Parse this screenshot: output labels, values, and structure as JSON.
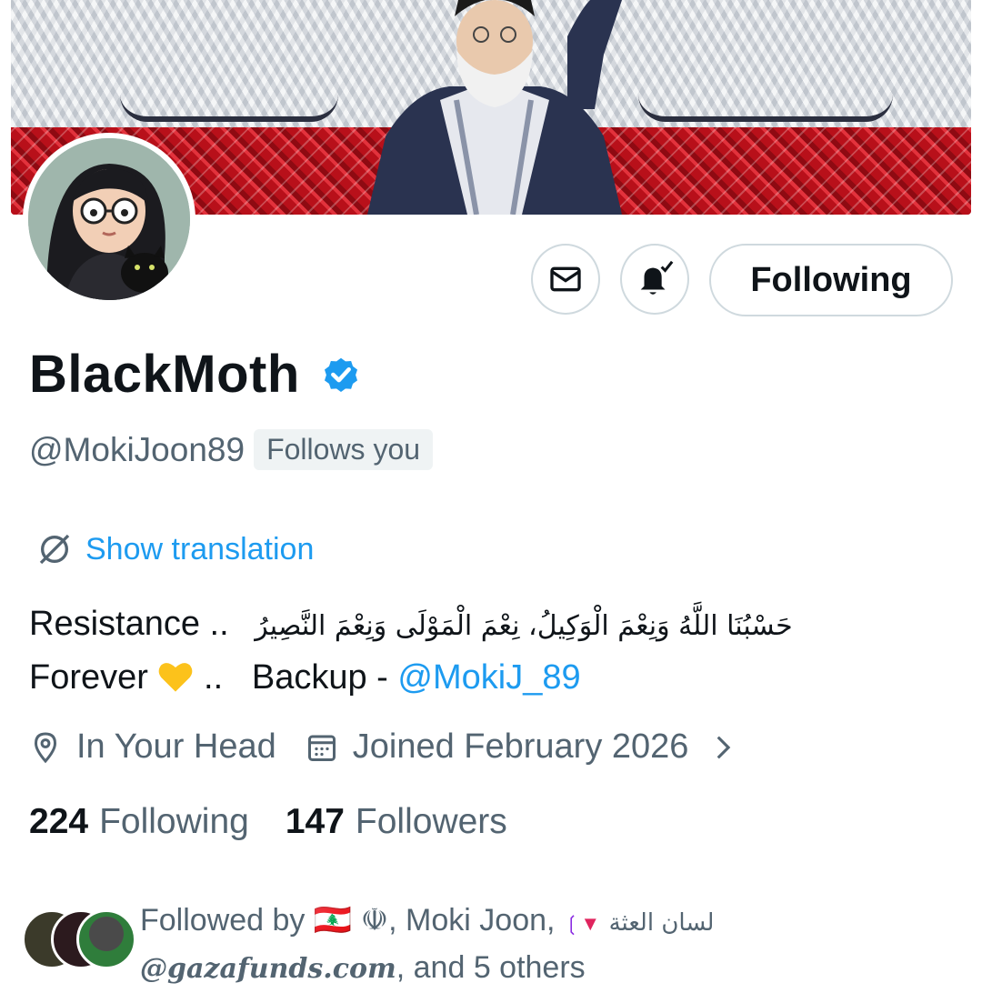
{
  "profile": {
    "display_name": "BlackMoth",
    "handle": "@MokiJoon89",
    "follows_you": "Follows you",
    "verified_icon": "verified-badge-icon"
  },
  "actions": {
    "message_icon": "mail-icon",
    "notify_icon": "bell-check-icon",
    "follow_label": "Following"
  },
  "translation": {
    "label": "Show translation",
    "icon": "translate-globe-icon"
  },
  "bio": {
    "word1": "Resistance ..",
    "arabic": "حَسْبُنَا اللَّهُ وَنِعْمَ الْوَكِيلُ، نِعْمَ الْمَوْلَى وَنِعْمَ النَّصِيرُ",
    "word2": "Forever",
    "emoji": "yellow-heart",
    "separator": "..",
    "backup_text": "Backup -",
    "backup_link": "@MokiJ_89"
  },
  "meta": {
    "location": "In Your Head",
    "joined": "Joined February 2026",
    "location_icon": "location-pin-icon",
    "calendar_icon": "calendar-icon",
    "chevron_icon": "chevron-right-icon"
  },
  "stats": {
    "following_count": "224",
    "following_label": "Following",
    "followers_count": "147",
    "followers_label": "Followers"
  },
  "followed_by": {
    "prefix": "Followed by",
    "flag": "🇱🇧",
    "symbol": "☫",
    "name2": ", Moki Joon,",
    "arabic_name": "لسان العثة",
    "name3": "@gazafunds.com",
    "suffix": ", and 5 others"
  },
  "colors": {
    "accent": "#1d9bf0",
    "muted": "#536471",
    "text": "#0f1419",
    "border": "#cfd9de"
  }
}
